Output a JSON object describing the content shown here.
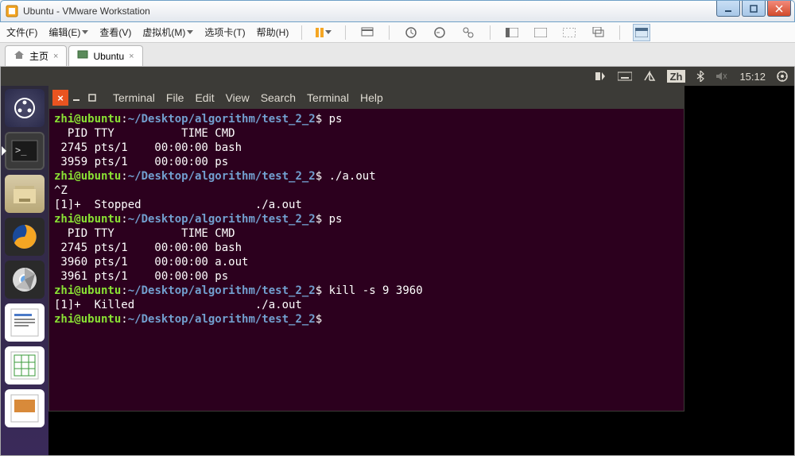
{
  "window": {
    "title": "Ubuntu - VMware Workstation"
  },
  "menu": {
    "file": "文件(F)",
    "edit": "编辑(E)",
    "view": "查看(V)",
    "vm": "虚拟机(M)",
    "tabs": "选项卡(T)",
    "help": "帮助(H)"
  },
  "tabs": {
    "home": "主页",
    "ubuntu": "Ubuntu"
  },
  "panel": {
    "lang": "Zh",
    "time": "15:12"
  },
  "terminal": {
    "menus": {
      "m0": "Terminal",
      "m1": "File",
      "m2": "Edit",
      "m3": "View",
      "m4": "Search",
      "m5": "Terminal",
      "m6": "Help"
    },
    "prompt_user": "zhi@ubuntu",
    "prompt_path": "~/Desktop/algorithm/test_2_2",
    "lines": {
      "cmd1": " ps",
      "out1": "  PID TTY          TIME CMD\n 2745 pts/1    00:00:00 bash\n 3959 pts/1    00:00:00 ps",
      "cmd2": " ./a.out",
      "out2": "^Z\n[1]+  Stopped                 ./a.out",
      "cmd3": " ps",
      "out3": "  PID TTY          TIME CMD\n 2745 pts/1    00:00:00 bash\n 3960 pts/1    00:00:00 a.out\n 3961 pts/1    00:00:00 ps",
      "cmd4": " kill -s 9 3960",
      "out4": "[1]+  Killed                  ./a.out",
      "cmd5": ""
    }
  }
}
